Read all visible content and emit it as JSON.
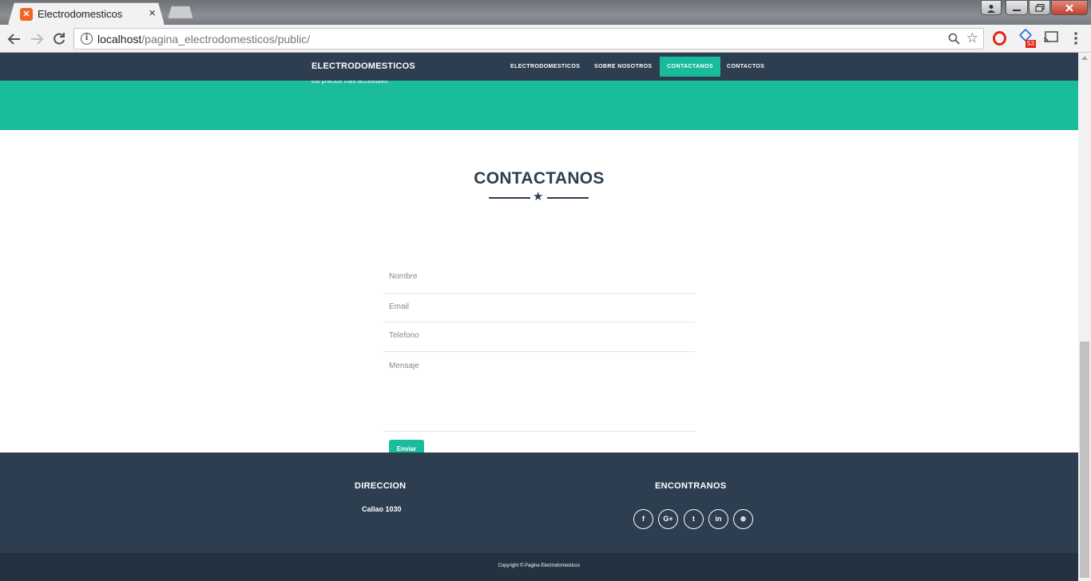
{
  "browser": {
    "tab_title": "Electrodomesticos",
    "tab_close": "×",
    "url_host": "localhost",
    "url_path": "/pagina_electrodomesticos/public/",
    "extension_badge": "53"
  },
  "navbar": {
    "brand": "ELECTRODOMESTICOS",
    "links": [
      "ELECTRODOMESTICOS",
      "SOBRE NOSOTROS",
      "CONTACTANOS",
      "CONTACTOS"
    ],
    "active_link": "CONTACTANOS"
  },
  "hero": {
    "text": "los precios más accesibles."
  },
  "contact": {
    "title": "CONTACTANOS",
    "fields": {
      "nombre": "Nombre",
      "email": "Email",
      "telefono": "Telefono",
      "mensaje": "Mensaje"
    },
    "submit": "Enviar"
  },
  "footer": {
    "address_heading": "DIRECCION",
    "address": "Callao 1030",
    "social_heading": "ENCONTRANOS",
    "social_icons": [
      "facebook-icon",
      "google-plus-icon",
      "twitter-icon",
      "linkedin-icon",
      "dribbble-icon"
    ],
    "social_glyphs": [
      "f",
      "G+",
      "t",
      "in",
      "⊛"
    ],
    "copyright": "Copyright © Pagina Electrodomesticos"
  },
  "colors": {
    "navbar": "#2c3e50",
    "accent": "#1abc9c",
    "footer_bottom": "#233140"
  }
}
